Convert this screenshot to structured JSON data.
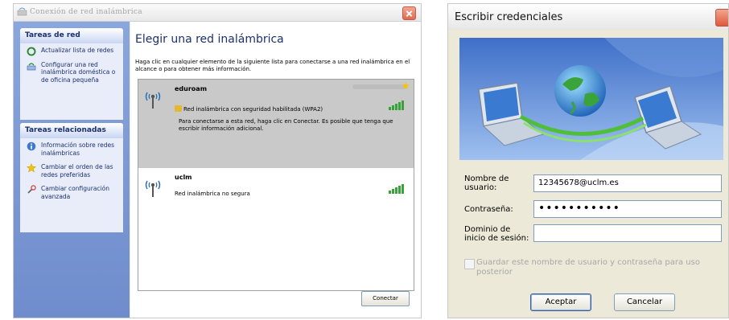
{
  "left_window": {
    "title": "Conexión de red inalámbrica",
    "tasks_title": "Tareas de red",
    "tasks": [
      {
        "label": "Actualizar lista de redes",
        "icon": "refresh-icon"
      },
      {
        "label": "Configurar una red inalámbrica doméstica o de oficina pequeña",
        "icon": "setup-network-icon"
      }
    ],
    "related_title": "Tareas relacionadas",
    "related": [
      {
        "label": "Información sobre redes inalámbricas",
        "icon": "info-icon"
      },
      {
        "label": "Cambiar el orden de las redes preferidas",
        "icon": "star-icon"
      },
      {
        "label": "Cambiar configuración avanzada",
        "icon": "settings-icon"
      }
    ],
    "heading": "Elegir una red inalámbrica",
    "description": "Haga clic en cualquier elemento de la siguiente lista para conectarse a una red inalámbrica en el alcance o para obtener más información.",
    "networks": [
      {
        "ssid": "eduroam",
        "security": "Red inalámbrica con seguridad habilitada (WPA2)",
        "detail": "Para conectarse a esta red, haga clic en Conectar. Es posible que tenga que escribir información adicional.",
        "preferred": true
      },
      {
        "ssid": "uclm",
        "security": "Red inalámbrica no segura"
      }
    ],
    "connect_button": "Conectar"
  },
  "right_window": {
    "title": "Escribir credenciales",
    "username_label_1": "Nombre de",
    "username_label_2": "usuario:",
    "username_value": "12345678@uclm.es",
    "password_label": "Contraseña:",
    "password_value": "•••••••••••",
    "domain_label_1": "Dominio de",
    "domain_label_2": "inicio de sesión:",
    "domain_value": "",
    "save_checkbox_label": "Guardar este nombre de usuario y contraseña para uso posterior",
    "ok_button": "Aceptar",
    "cancel_button": "Cancelar"
  },
  "colors": {
    "sidebar": "#7f9ad6",
    "signal": "#39a33b",
    "selected_row": "#c9c9c9"
  }
}
